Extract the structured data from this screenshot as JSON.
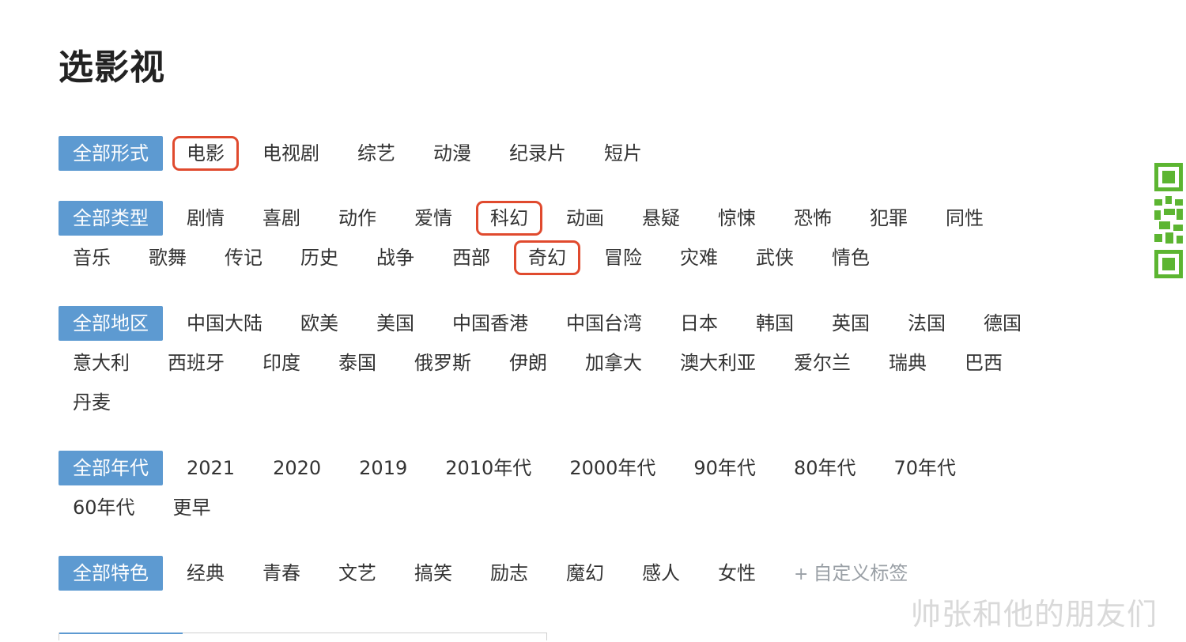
{
  "page": {
    "title": "选影视"
  },
  "filters": [
    {
      "key": "format",
      "all_label": "全部形式",
      "items": [
        "电影",
        "电视剧",
        "综艺",
        "动漫",
        "纪录片",
        "短片"
      ],
      "highlighted": [
        "电影"
      ]
    },
    {
      "key": "genre",
      "all_label": "全部类型",
      "items": [
        "剧情",
        "喜剧",
        "动作",
        "爱情",
        "科幻",
        "动画",
        "悬疑",
        "惊悚",
        "恐怖",
        "犯罪",
        "同性",
        "音乐",
        "歌舞",
        "传记",
        "历史",
        "战争",
        "西部",
        "奇幻",
        "冒险",
        "灾难",
        "武侠",
        "情色"
      ],
      "highlighted": [
        "科幻",
        "奇幻"
      ]
    },
    {
      "key": "region",
      "all_label": "全部地区",
      "items": [
        "中国大陆",
        "欧美",
        "美国",
        "中国香港",
        "中国台湾",
        "日本",
        "韩国",
        "英国",
        "法国",
        "德国",
        "意大利",
        "西班牙",
        "印度",
        "泰国",
        "俄罗斯",
        "伊朗",
        "加拿大",
        "澳大利亚",
        "爱尔兰",
        "瑞典",
        "巴西",
        "丹麦"
      ],
      "highlighted": []
    },
    {
      "key": "decade",
      "all_label": "全部年代",
      "items": [
        "2021",
        "2020",
        "2019",
        "2010年代",
        "2000年代",
        "90年代",
        "80年代",
        "70年代",
        "60年代",
        "更早"
      ],
      "highlighted": []
    },
    {
      "key": "feature",
      "all_label": "全部特色",
      "items": [
        "经典",
        "青春",
        "文艺",
        "搞笑",
        "励志",
        "魔幻",
        "感人",
        "女性"
      ],
      "highlighted": [],
      "custom_label": "自定义标签",
      "custom_prefix": "+"
    }
  ],
  "qr": {
    "icon": "qr-code-icon",
    "color": "#5cb531"
  },
  "watermark": "帅张和他的朋友们",
  "colors": {
    "accent": "#5d9ad1",
    "highlight": "#e04a2e",
    "text": "#333333",
    "muted": "#9aa0a6"
  }
}
